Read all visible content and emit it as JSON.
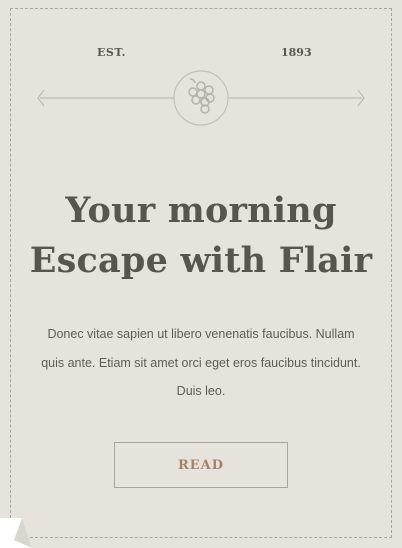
{
  "header": {
    "est_label": "EST.",
    "year_label": "1893",
    "emblem_icon": "grapes-icon"
  },
  "hero": {
    "headline_line1": "Your morning",
    "headline_line2": "Escape with Flair",
    "body_text": "Donec vitae sapien ut libero venenatis faucibus. Nullam quis ante. Etiam sit amet orci eget eros faucibus tincidunt. Duis leo."
  },
  "cta": {
    "read_label": "READ"
  },
  "colors": {
    "background": "#e6e3dc",
    "text": "#58554f",
    "accent": "#a58466",
    "line": "#bdbab4"
  }
}
